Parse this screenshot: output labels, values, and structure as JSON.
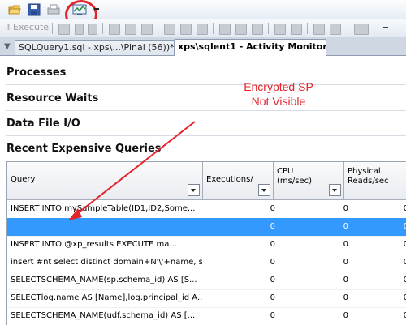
{
  "toolbar": {
    "execute_label": "Execute",
    "icons": [
      "open-file-icon",
      "save-icon",
      "print-icon",
      "activity-monitor-icon",
      "dropdown-chevron-icon"
    ]
  },
  "tabs": [
    {
      "label": "SQLQuery1.sql - xps\\...\\Pinal (56))*",
      "active": false
    },
    {
      "label": "xps\\sqlent1 - Activity Monitor",
      "active": true
    }
  ],
  "sections": [
    "Processes",
    "Resource Waits",
    "Data File I/O",
    "Recent Expensive Queries"
  ],
  "annotation": {
    "line1": "Encrypted SP",
    "line2": "Not Visible",
    "color": "#e3242b"
  },
  "grid": {
    "columns": [
      {
        "line1": "Query",
        "line2": ""
      },
      {
        "line1": "Executions/",
        "line2": ""
      },
      {
        "line1": "CPU",
        "line2": "(ms/sec)"
      },
      {
        "line1": "Physical",
        "line2": "Reads/sec"
      }
    ],
    "rows": [
      {
        "query": "INSERT INTO mySampleTable(ID1,ID2,Some...",
        "executions": "0",
        "cpu": "0",
        "reads": "0",
        "selected": false
      },
      {
        "query": "",
        "executions": "0",
        "cpu": "0",
        "reads": "0",
        "selected": true
      },
      {
        "query": "INSERT INTO @xp_results       EXECUTE ma...",
        "executions": "0",
        "cpu": "0",
        "reads": "0",
        "selected": false
      },
      {
        "query": "insert #nt select distinct domain+N'\\'+name, sid...",
        "executions": "0",
        "cpu": "0",
        "reads": "0",
        "selected": false
      },
      {
        "query": "SELECTSCHEMA_NAME(sp.schema_id) AS [S...",
        "executions": "0",
        "cpu": "0",
        "reads": "0",
        "selected": false
      },
      {
        "query": "SELECTlog.name AS [Name],log.principal_id A...",
        "executions": "0",
        "cpu": "0",
        "reads": "0",
        "selected": false
      },
      {
        "query": "SELECTSCHEMA_NAME(udf.schema_id) AS [...",
        "executions": "0",
        "cpu": "0",
        "reads": "0",
        "selected": false
      }
    ],
    "selection_color": "#3399ff"
  }
}
